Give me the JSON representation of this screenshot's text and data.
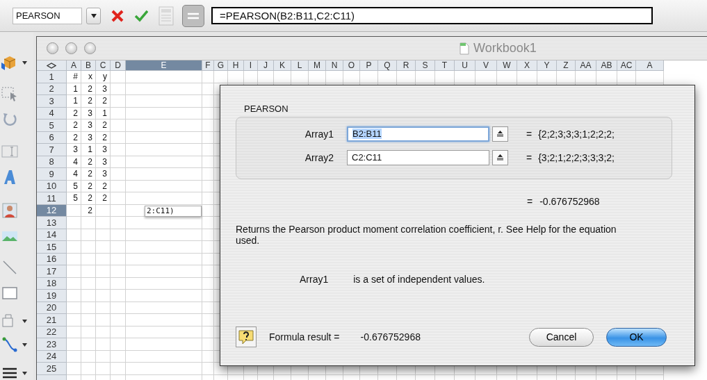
{
  "formula_bar": {
    "name_box": "PEARSON",
    "formula": "=PEARSON(B2:B11,C2:C11)",
    "calculator_disabled": true,
    "equals_pressed": true
  },
  "window": {
    "title": "Workbook1"
  },
  "sheet": {
    "columns": [
      {
        "label": "A",
        "selected": false
      },
      {
        "label": "B",
        "selected": false
      },
      {
        "label": "C",
        "selected": false
      },
      {
        "label": "D",
        "selected": false
      },
      {
        "label": "E",
        "selected": true
      },
      {
        "label": "F",
        "selected": false
      },
      {
        "label": "G",
        "selected": false
      },
      {
        "label": "H",
        "selected": false
      },
      {
        "label": "I",
        "selected": false
      },
      {
        "label": "J",
        "selected": false
      },
      {
        "label": "K",
        "selected": false
      },
      {
        "label": "L",
        "selected": false
      },
      {
        "label": "M",
        "selected": false
      },
      {
        "label": "N",
        "selected": false
      },
      {
        "label": "O",
        "selected": false
      },
      {
        "label": "P",
        "selected": false
      },
      {
        "label": "Q",
        "selected": false
      },
      {
        "label": "R",
        "selected": false
      },
      {
        "label": "S",
        "selected": false
      },
      {
        "label": "T",
        "selected": false
      },
      {
        "label": "U",
        "selected": false
      },
      {
        "label": "V",
        "selected": false
      },
      {
        "label": "W",
        "selected": false
      },
      {
        "label": "X",
        "selected": false
      },
      {
        "label": "Y",
        "selected": false
      },
      {
        "label": "Z",
        "selected": false
      },
      {
        "label": "AA",
        "selected": false
      },
      {
        "label": "AB",
        "selected": false
      },
      {
        "label": "AC",
        "selected": false
      },
      {
        "label": "A",
        "selected": false
      }
    ],
    "rows": [
      {
        "label": "1",
        "selected": false,
        "cells": {
          "a": "#",
          "b": "x",
          "c": "y"
        }
      },
      {
        "label": "2",
        "selected": false,
        "cells": {
          "a": "1",
          "b": "2",
          "c": "3"
        }
      },
      {
        "label": "3",
        "selected": false,
        "cells": {
          "a": "1",
          "b": "2",
          "c": "2"
        }
      },
      {
        "label": "4",
        "selected": false,
        "cells": {
          "a": "2",
          "b": "3",
          "c": "1"
        }
      },
      {
        "label": "5",
        "selected": false,
        "cells": {
          "a": "2",
          "b": "3",
          "c": "2"
        }
      },
      {
        "label": "6",
        "selected": false,
        "cells": {
          "a": "2",
          "b": "3",
          "c": "2"
        }
      },
      {
        "label": "7",
        "selected": false,
        "cells": {
          "a": "3",
          "b": "1",
          "c": "3"
        }
      },
      {
        "label": "8",
        "selected": false,
        "cells": {
          "a": "4",
          "b": "2",
          "c": "3"
        }
      },
      {
        "label": "9",
        "selected": false,
        "cells": {
          "a": "4",
          "b": "2",
          "c": "3"
        }
      },
      {
        "label": "10",
        "selected": false,
        "cells": {
          "a": "5",
          "b": "2",
          "c": "2"
        }
      },
      {
        "label": "11",
        "selected": false,
        "cells": {
          "a": "5",
          "b": "2",
          "c": "2"
        }
      },
      {
        "label": "12",
        "selected": true,
        "cells": {
          "b": "2"
        },
        "editor": "2:C11)"
      },
      {
        "label": "13",
        "selected": false
      },
      {
        "label": "14",
        "selected": false
      },
      {
        "label": "15",
        "selected": false
      },
      {
        "label": "16",
        "selected": false
      },
      {
        "label": "17",
        "selected": false
      },
      {
        "label": "18",
        "selected": false
      },
      {
        "label": "19",
        "selected": false
      },
      {
        "label": "20",
        "selected": false
      },
      {
        "label": "21",
        "selected": false
      },
      {
        "label": "22",
        "selected": false
      },
      {
        "label": "23",
        "selected": false
      },
      {
        "label": "24",
        "selected": false
      },
      {
        "label": "25",
        "selected": false
      }
    ]
  },
  "dialog": {
    "function": "PEARSON",
    "arguments": [
      {
        "label": "Array1",
        "value": "B2:B11",
        "focused": true,
        "sign": "=",
        "result": "{2;2;3;3;3;1;2;2;2;"
      },
      {
        "label": "Array2",
        "value": "C2:C11",
        "focused": false,
        "sign": "=",
        "result": "{3;2;1;2;2;3;3;3;2;"
      }
    ],
    "result": {
      "sign": "=",
      "value": "-0.676752968"
    },
    "description": "Returns the Pearson product moment correlation coefficient, r. See Help for the equation used.",
    "argument_help": {
      "name": "Array1",
      "text": "is a set of independent values."
    },
    "formula_result": {
      "label": "Formula result =",
      "value": "-0.676752968"
    },
    "buttons": [
      {
        "label": "Cancel",
        "default": false
      },
      {
        "label": "OK",
        "default": true
      }
    ]
  }
}
